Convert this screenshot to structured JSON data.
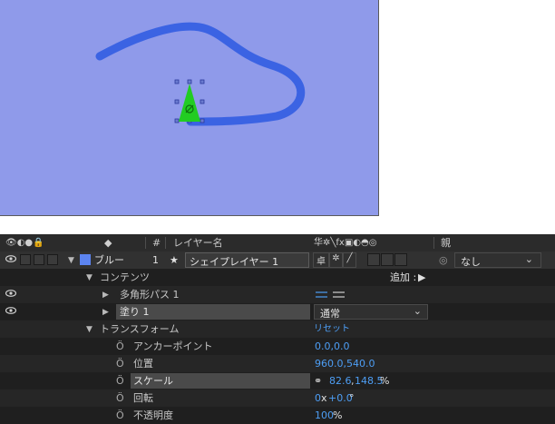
{
  "header": {
    "label_col": "#",
    "name_col": "レイヤー名",
    "switch_icons": "华✲╲fx▣◐◓◎",
    "parent_col": "親"
  },
  "layer": {
    "name": "ブルー",
    "number": "1",
    "title_value": "シェイプレイヤー 1",
    "parent_value": "なし",
    "color": "#5c84f0"
  },
  "contents": {
    "label": "コンテンツ",
    "add_label": "追加 :",
    "polygon_path": "多角形パス 1",
    "fill": "塗り 1",
    "blend_mode": "通常"
  },
  "transform": {
    "label": "トランスフォーム",
    "reset": "リセット",
    "anchor_label": "アンカーポイント",
    "anchor_value": "0.0,0.0",
    "position_label": "位置",
    "position_value": "960.0,540.0",
    "scale_label": "スケール",
    "scale_x": "82.6",
    "scale_y": "148.5",
    "scale_unit": "%",
    "rotation_label": "回転",
    "rotation_turns": "0",
    "rotation_x": "x",
    "rotation_deg": "+0.0",
    "rotation_unit": "°",
    "opacity_label": "不透明度",
    "opacity_value": "100",
    "opacity_unit": "%"
  },
  "colors": {
    "comp_bg": "#8f9aea",
    "stroke": "#3b63e3",
    "shape": "#22cc22",
    "accent_blue": "#4d9ef5"
  }
}
